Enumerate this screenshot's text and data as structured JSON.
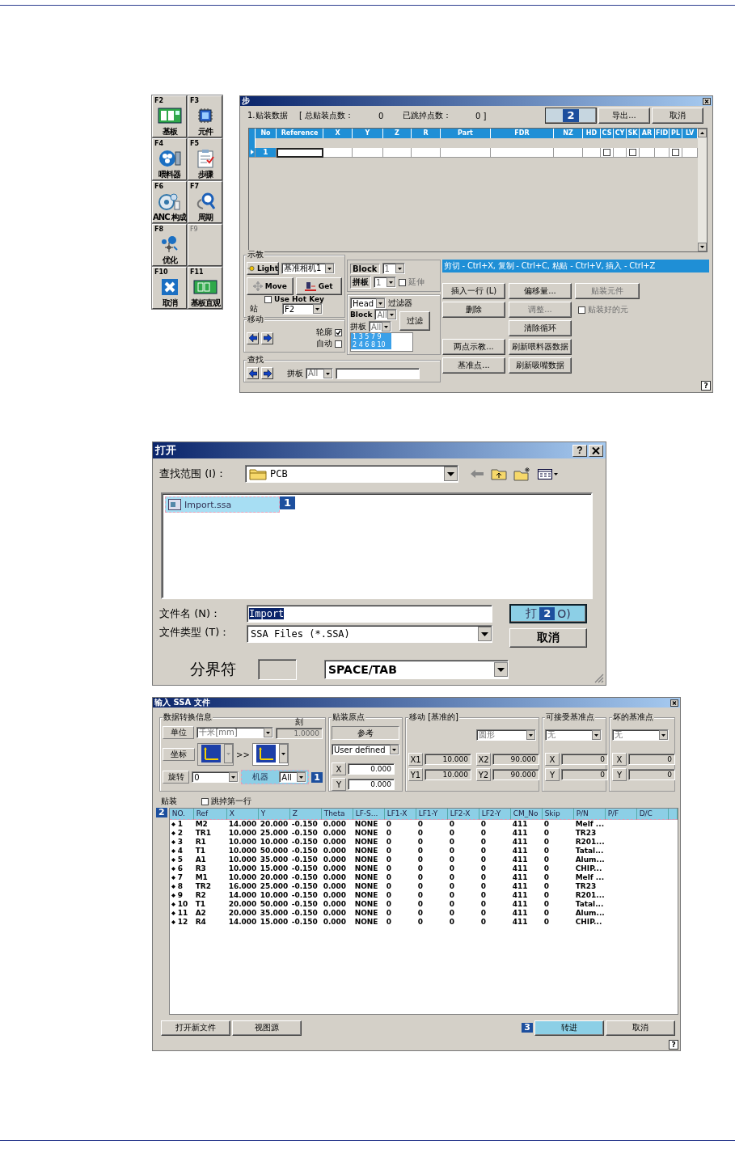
{
  "toolbar": {
    "keys": [
      {
        "key": "F2",
        "label": "基板",
        "disabled": false
      },
      {
        "key": "F3",
        "label": "元件",
        "disabled": false
      },
      {
        "key": "F4",
        "label": "喂料器",
        "disabled": false
      },
      {
        "key": "F5",
        "label": "步骤",
        "disabled": false
      },
      {
        "key": "F6",
        "label": "ANC 构成",
        "disabled": false
      },
      {
        "key": "F7",
        "label": "周期",
        "disabled": false
      },
      {
        "key": "F8",
        "label": "优化",
        "disabled": false
      },
      {
        "key": "F9",
        "disabled": true
      },
      {
        "key": "F10",
        "label": "取消",
        "disabled": false
      },
      {
        "key": "F11",
        "label": "基板直观",
        "disabled": false
      }
    ]
  },
  "step_window": {
    "title": "步",
    "summary": [
      "1.贴装数据",
      "[ 总贴装点数：",
      "0",
      "已跳掉点数：",
      "0 ]"
    ],
    "marked_button": {
      "callout": "2"
    },
    "buttons": [
      "导出...",
      "取消"
    ],
    "table": {
      "columns": [
        "No",
        "Reference",
        "X",
        "Y",
        "Z",
        "R",
        "Part",
        "FDR",
        "NZ",
        "HD",
        "CS",
        "CY",
        "SK",
        "AR",
        "FID",
        "PL",
        "LV"
      ],
      "rows": [
        {
          "current": true,
          "cells": [
            {
              "kind": "text",
              "text": "1"
            },
            {
              "kind": "edit"
            },
            {
              "kind": "empty"
            },
            {
              "kind": "empty"
            },
            {
              "kind": "empty"
            },
            {
              "kind": "empty"
            },
            {
              "kind": "empty"
            },
            {
              "kind": "empty"
            },
            {
              "kind": "empty"
            },
            {
              "kind": "empty"
            },
            {
              "kind": "checkbox",
              "checked": false
            },
            {
              "kind": "empty"
            },
            {
              "kind": "checkbox",
              "checked": false
            },
            {
              "kind": "empty"
            },
            {
              "kind": "empty"
            },
            {
              "kind": "checkbox",
              "checked": false
            },
            {
              "kind": "empty"
            }
          ]
        }
      ]
    },
    "teach": {
      "title": "示教",
      "light": "Light",
      "camera": {
        "value": "基准相机1",
        "disabled": false
      },
      "move": "Move",
      "get": "Get",
      "hot_key": {
        "label": "Use Hot Key",
        "checked": false
      },
      "station_label": "站",
      "station": {
        "value": "F2",
        "disabled": false
      }
    },
    "move": {
      "title": "移动",
      "outline": {
        "label": "轮廓",
        "checked": true
      },
      "auto": {
        "label": "自动",
        "checked": false
      }
    },
    "block": {
      "block_label": "Block",
      "block": {
        "value": "1",
        "disabled": true
      },
      "panel_label": "拼板",
      "panel": {
        "value": "1",
        "disabled": true
      },
      "extend": {
        "label": "延伸",
        "checked": false,
        "disabled": true
      }
    },
    "filter": {
      "head": {
        "value": "Head",
        "disabled": false
      },
      "title": "过滤器",
      "block_label": "Block",
      "block": {
        "value": "All",
        "disabled": true
      },
      "panel_label": "拼板",
      "panel": {
        "value": "All",
        "disabled": true
      },
      "button": "过滤",
      "list": [
        {
          "text": "1 3 5 7 9",
          "selected": true
        },
        {
          "text": "2 4 6 8 10",
          "selected": true
        }
      ]
    },
    "find": {
      "title": "查找",
      "panel_label": "拼板",
      "panel": {
        "value": "All",
        "disabled": true
      }
    },
    "hint": "剪切 - Ctrl+X, 复制 - Ctrl+C, 粘贴 - Ctrl+V, 插入 - Ctrl+Z",
    "actions": [
      {
        "kind": "button",
        "label": "插入一行 (L)",
        "disabled": false
      },
      {
        "kind": "button",
        "label": "偏移量...",
        "disabled": false
      },
      {
        "kind": "button",
        "label": "贴装元件",
        "disabled": true
      },
      {
        "kind": "button",
        "label": "删除",
        "disabled": false
      },
      {
        "kind": "button",
        "label": "调整...",
        "disabled": true
      },
      {
        "kind": "checkbox",
        "label": "贴装好的元",
        "checked": false,
        "disabled": true
      },
      {
        "kind": "blank"
      },
      {
        "kind": "button",
        "label": "清除循环",
        "disabled": false
      },
      {
        "kind": "blank"
      },
      {
        "kind": "button",
        "label": "两点示教...",
        "disabled": false
      },
      {
        "kind": "button",
        "label": "刷新喂料器数据",
        "disabled": false
      },
      {
        "kind": "blank"
      },
      {
        "kind": "button",
        "label": "基准点...",
        "disabled": false
      },
      {
        "kind": "button",
        "label": "刷新吸嘴数据",
        "disabled": false
      }
    ],
    "help": "?"
  },
  "open_dialog": {
    "title": "打开",
    "help": "?",
    "look_in_label": "查找范围 (I)：",
    "look_in": "PCB",
    "files": [
      {
        "name": "Import.ssa",
        "selected": true,
        "callout": "1"
      }
    ],
    "file_name_label": "文件名 (N)：",
    "file_name": "Import",
    "open_button": {
      "label_start": "打",
      "label_end": "O)",
      "callout": "2",
      "highlighted": true
    },
    "file_type_label": "文件类型 (T)：",
    "file_type": "SSA Files (*.SSA)",
    "cancel": "取消",
    "delimiter_label": "分界符",
    "delimiter": "SPACE/TAB"
  },
  "import_dialog": {
    "title": "输入 SSA 文件",
    "conversion": {
      "title": "数据转换信息",
      "unit_label": "单位",
      "unit": {
        "value": "千米[mm]",
        "disabled": true
      },
      "scale_label": "刻",
      "scale": "1.0000",
      "coord_label": "坐标",
      "coord_arrow": ">>",
      "rotate_label": "旋转",
      "rotate": {
        "value": "0",
        "disabled": false
      },
      "machine": {
        "label": "机器",
        "value": "All",
        "highlighted": true,
        "callout": "1"
      }
    },
    "origin": {
      "title": "贴装原点",
      "reference": "参考",
      "mode": {
        "value": "User defined",
        "disabled": false
      },
      "fields": [
        {
          "label": "X",
          "value": "0.000"
        },
        {
          "label": "Y",
          "value": "0.000"
        }
      ]
    },
    "shift": {
      "title": "移动 [基准的]",
      "shape": {
        "value": "圆形",
        "disabled": true
      },
      "fields": [
        {
          "label": "X1",
          "value": "10.000"
        },
        {
          "label": "X2",
          "value": "90.000"
        },
        {
          "label": "Y1",
          "value": "10.000"
        },
        {
          "label": "Y2",
          "value": "90.000"
        }
      ]
    },
    "accepted": {
      "title": "可接受基准点",
      "mode": {
        "value": "无",
        "disabled": true
      },
      "fields": [
        {
          "label": "X",
          "value": "0"
        },
        {
          "label": "Y",
          "value": "0"
        }
      ]
    },
    "bad": {
      "title": "坏的基准点",
      "mode": {
        "value": "无",
        "disabled": true
      },
      "fields": [
        {
          "label": "X",
          "value": "0"
        },
        {
          "label": "Y",
          "value": "0"
        }
      ]
    },
    "placement_label": "贴装",
    "skip_first": {
      "label": "跳掉第一行",
      "checked": false
    },
    "table": {
      "callout": "2",
      "columns": [
        "NO.",
        "Ref",
        "X",
        "Y",
        "Z",
        "Theta",
        "LF-S...",
        "LF1-X",
        "LF1-Y",
        "LF2-X",
        "LF2-Y",
        "CM_No",
        "Skip",
        "P/N",
        "P/F",
        "D/C"
      ],
      "rows": [
        [
          "1",
          "M2",
          "14.000",
          "20.000",
          "-0.150",
          "0.000",
          "NONE",
          "0",
          "0",
          "0",
          "0",
          "411",
          "0",
          "Melf ..."
        ],
        [
          "2",
          "TR1",
          "10.000",
          "25.000",
          "-0.150",
          "0.000",
          "NONE",
          "0",
          "0",
          "0",
          "0",
          "411",
          "0",
          "TR23"
        ],
        [
          "3",
          "R1",
          "10.000",
          "10.000",
          "-0.150",
          "0.000",
          "NONE",
          "0",
          "0",
          "0",
          "0",
          "411",
          "0",
          "R201..."
        ],
        [
          "4",
          "T1",
          "10.000",
          "50.000",
          "-0.150",
          "0.000",
          "NONE",
          "0",
          "0",
          "0",
          "0",
          "411",
          "0",
          "Tatal..."
        ],
        [
          "5",
          "A1",
          "10.000",
          "35.000",
          "-0.150",
          "0.000",
          "NONE",
          "0",
          "0",
          "0",
          "0",
          "411",
          "0",
          "Alum..."
        ],
        [
          "6",
          "R3",
          "10.000",
          "15.000",
          "-0.150",
          "0.000",
          "NONE",
          "0",
          "0",
          "0",
          "0",
          "411",
          "0",
          "CHIP..."
        ],
        [
          "7",
          "M1",
          "10.000",
          "20.000",
          "-0.150",
          "0.000",
          "NONE",
          "0",
          "0",
          "0",
          "0",
          "411",
          "0",
          "Melf ..."
        ],
        [
          "8",
          "TR2",
          "16.000",
          "25.000",
          "-0.150",
          "0.000",
          "NONE",
          "0",
          "0",
          "0",
          "0",
          "411",
          "0",
          "TR23"
        ],
        [
          "9",
          "R2",
          "14.000",
          "10.000",
          "-0.150",
          "0.000",
          "NONE",
          "0",
          "0",
          "0",
          "0",
          "411",
          "0",
          "R201..."
        ],
        [
          "10",
          "T1",
          "20.000",
          "50.000",
          "-0.150",
          "0.000",
          "NONE",
          "0",
          "0",
          "0",
          "0",
          "411",
          "0",
          "Tatal..."
        ],
        [
          "11",
          "A2",
          "20.000",
          "35.000",
          "-0.150",
          "0.000",
          "NONE",
          "0",
          "0",
          "0",
          "0",
          "411",
          "0",
          "Alum..."
        ],
        [
          "12",
          "R4",
          "14.000",
          "15.000",
          "-0.150",
          "0.000",
          "NONE",
          "0",
          "0",
          "0",
          "0",
          "411",
          "0",
          "CHIP..."
        ]
      ]
    },
    "buttons": [
      {
        "label": "打开新文件",
        "highlighted": false
      },
      {
        "label": "视图源",
        "highlighted": false
      },
      {
        "label": "转进",
        "highlighted": true,
        "callout": "3"
      },
      {
        "label": "取消",
        "highlighted": false
      }
    ],
    "help": "?"
  }
}
